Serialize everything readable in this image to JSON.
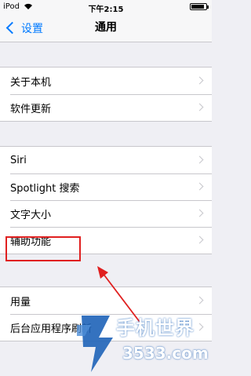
{
  "status_bar": {
    "carrier": "iPod",
    "time": "下午2:15",
    "battery_level": 0.9
  },
  "nav": {
    "back_label": "设置",
    "title": "通用"
  },
  "groups": [
    {
      "items": [
        {
          "label": "关于本机"
        },
        {
          "label": "软件更新"
        }
      ]
    },
    {
      "items": [
        {
          "label": "Siri"
        },
        {
          "label": "Spotlight 搜索"
        },
        {
          "label": "文字大小"
        },
        {
          "label": "辅助功能"
        }
      ]
    },
    {
      "items": [
        {
          "label": "用量"
        },
        {
          "label": "后台应用程序刷新"
        }
      ]
    }
  ],
  "annotation": {
    "color": "#e02020"
  },
  "watermark": {
    "brand": "手机世界",
    "sub": "3533.com",
    "color": "#1e63b8"
  }
}
